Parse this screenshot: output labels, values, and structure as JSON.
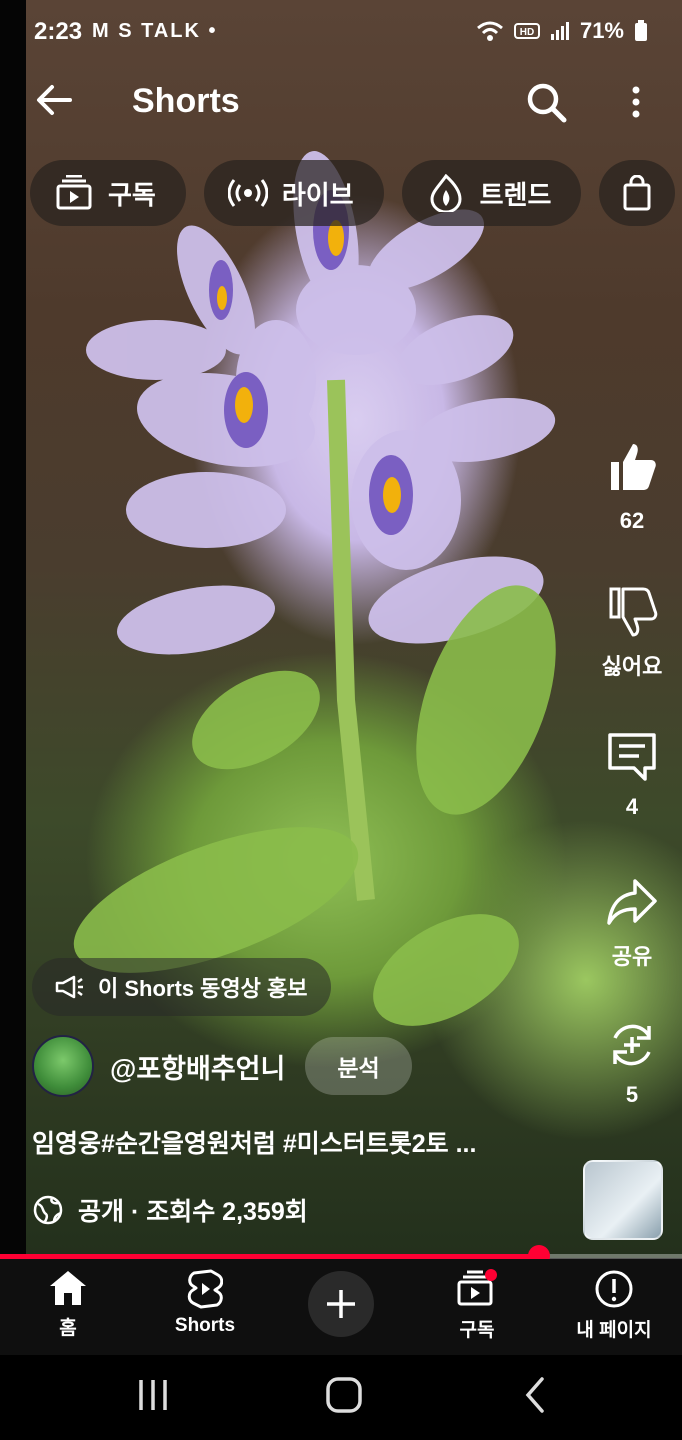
{
  "status": {
    "time": "2:23",
    "left_icons": "M S TALK •",
    "battery": "71%"
  },
  "header": {
    "title": "Shorts"
  },
  "chips": [
    {
      "label": "구독",
      "icon": "subscriptions-icon"
    },
    {
      "label": "라이브",
      "icon": "live-icon"
    },
    {
      "label": "트렌드",
      "icon": "trending-icon"
    }
  ],
  "rail": {
    "like_count": "62",
    "dislike_label": "싫어요",
    "comment_count": "4",
    "share_label": "공유",
    "remix_count": "5"
  },
  "promo": {
    "label": "이 Shorts 동영상 홍보"
  },
  "channel": {
    "name": "@포항배추언니",
    "analyze_label": "분석"
  },
  "video": {
    "caption": "임영웅#순간을영원처럼 #미스터트롯2토 ...",
    "meta": "공개 · 조회수 2,359회",
    "progress": 0.79
  },
  "bottom_nav": [
    {
      "label": "홈",
      "icon": "home-icon"
    },
    {
      "label": "Shorts",
      "icon": "shorts-icon"
    },
    {
      "label": "",
      "icon": "create-icon"
    },
    {
      "label": "구독",
      "icon": "subscriptions-icon"
    },
    {
      "label": "내 페이지",
      "icon": "my-page-icon"
    }
  ],
  "colors": {
    "accent": "#ff0033",
    "nav_bg": "#0f0f0f"
  }
}
